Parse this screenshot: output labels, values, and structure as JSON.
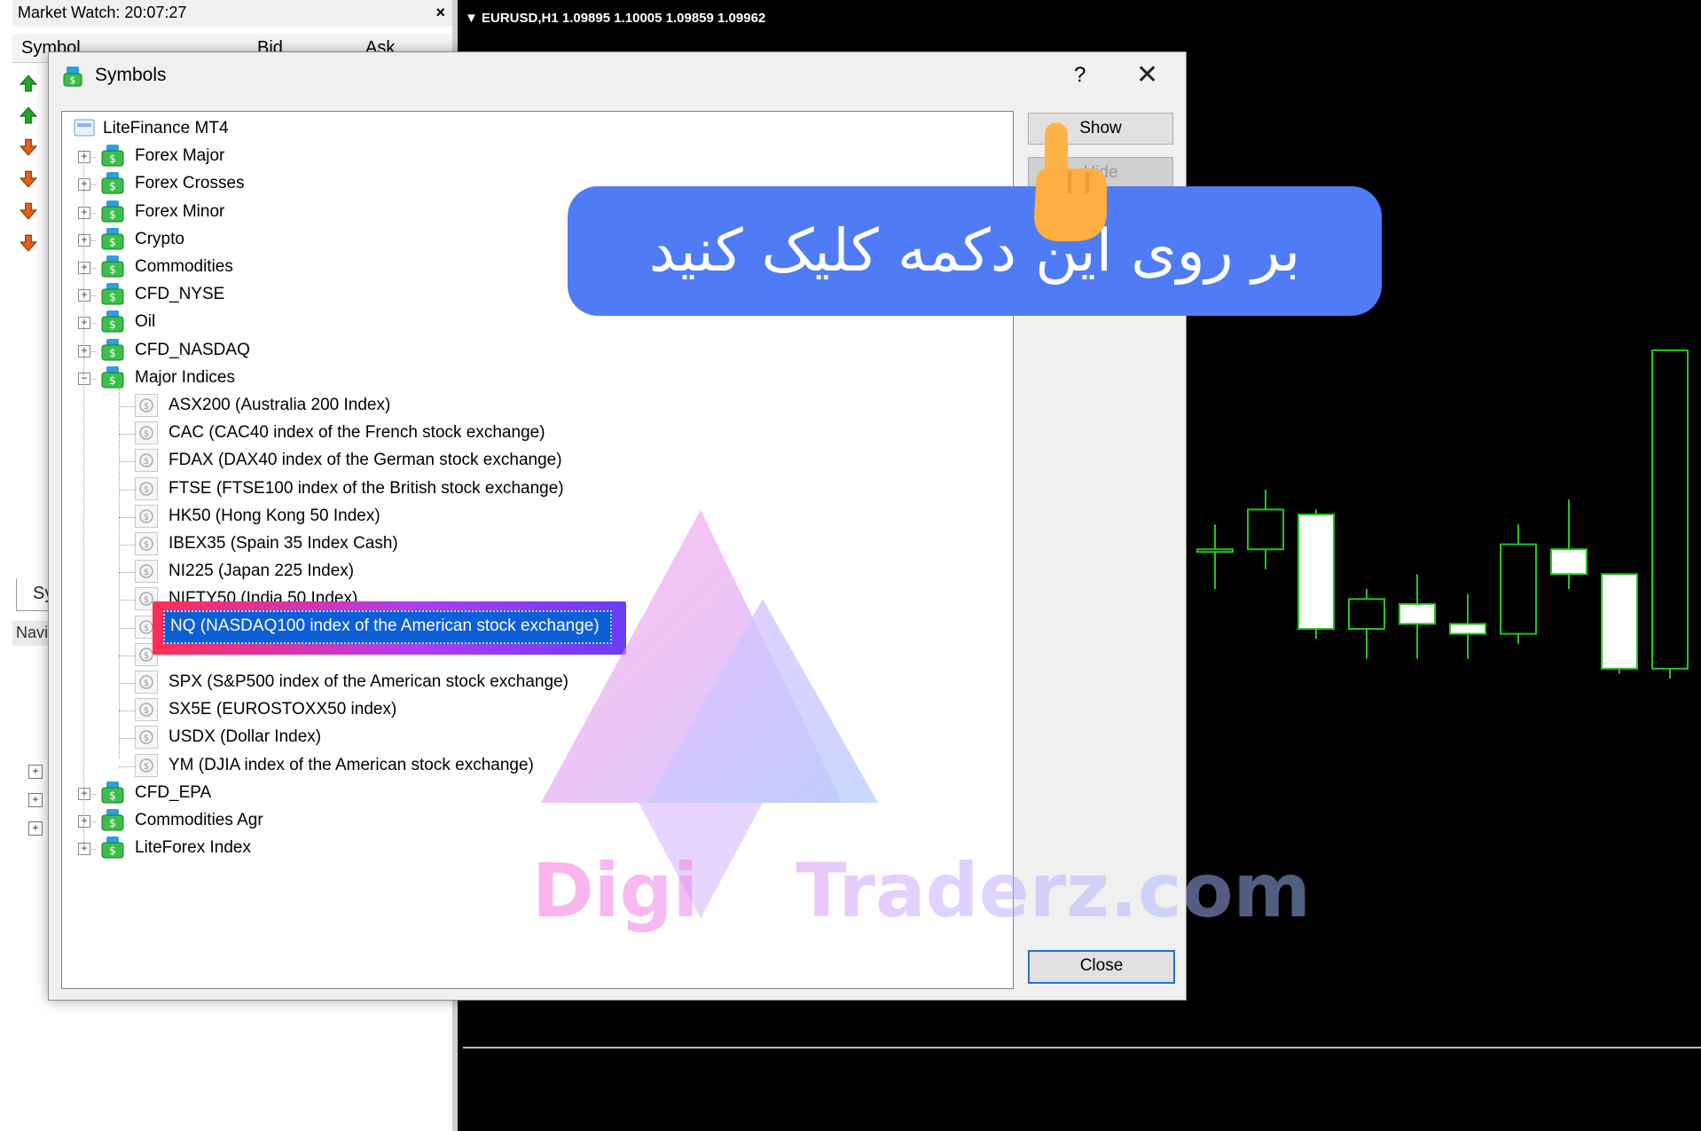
{
  "market_watch": {
    "title": "Market Watch: 20:07:27",
    "columns": [
      "Symbol",
      "Bid",
      "Ask"
    ],
    "close_glyph": "×",
    "tab_label": "Sy",
    "navigator_label": "Navi"
  },
  "chart": {
    "title": "▼ EURUSD,H1  1.09895 1.10005 1.09859 1.09962",
    "candle_color": "#24c61a",
    "candles": [
      {
        "o": 1.099,
        "h": 1.0995,
        "l": 1.0982,
        "c": 1.099
      },
      {
        "o": 1.099,
        "h": 1.1002,
        "l": 1.0986,
        "c": 1.0998
      },
      {
        "o": 1.0997,
        "h": 1.0998,
        "l": 1.0972,
        "c": 1.0974
      },
      {
        "o": 1.0974,
        "h": 1.0982,
        "l": 1.0968,
        "c": 1.098
      },
      {
        "o": 1.0979,
        "h": 1.0985,
        "l": 1.0968,
        "c": 1.0975
      },
      {
        "o": 1.0975,
        "h": 1.0981,
        "l": 1.0968,
        "c": 1.0973
      },
      {
        "o": 1.0973,
        "h": 1.0995,
        "l": 1.0971,
        "c": 1.0991
      },
      {
        "o": 1.099,
        "h": 1.1,
        "l": 1.0982,
        "c": 1.0985
      },
      {
        "o": 1.0985,
        "h": 1.0985,
        "l": 1.0965,
        "c": 1.0966
      },
      {
        "o": 1.0966,
        "h": 1.103,
        "l": 1.0964,
        "c": 1.103
      }
    ]
  },
  "dialog": {
    "title": "Symbols",
    "help_glyph": "?",
    "close_glyph": "✕",
    "buttons": {
      "show": "Show",
      "hide": "Hide",
      "close": "Close"
    },
    "root": "LiteFinance MT4",
    "groups_top": [
      "Forex Major",
      "Forex Crosses",
      "Forex Minor",
      "Crypto",
      "Commodities",
      "CFD_NYSE",
      "Oil",
      "CFD_NASDAQ"
    ],
    "expanded_group": "Major Indices",
    "symbols": [
      "ASX200  (Australia 200 Index)",
      "CAC  (CAC40 index of the French stock exchange)",
      "FDAX  (DAX40 index of the German stock exchange)",
      "FTSE  (FTSE100 index of the British stock exchange)",
      "HK50  (Hong Kong 50 Index)",
      "IBEX35  (Spain 35 Index Cash)",
      "NI225  (Japan 225 Index)",
      "NIFTY50  (India 50 Index)",
      "NQ  (NASDAQ100 index of the American stock exchange)",
      "",
      "SPX  (S&P500 index of the American stock exchange)",
      "SX5E  (EUROSTOXX50 index)",
      "USDX  (Dollar Index)",
      "YM  (DJIA index of the American stock exchange)"
    ],
    "selected_index": 8,
    "groups_bottom": [
      "CFD_EPA",
      "Commodities Agr",
      "LiteForex Index"
    ]
  },
  "overlay": {
    "callout_text": "بر روی این دکمه کلیک کنید",
    "callout_color": "#4f7cf5",
    "watermark_left": "Digi",
    "watermark_right": "Traderz.com"
  }
}
